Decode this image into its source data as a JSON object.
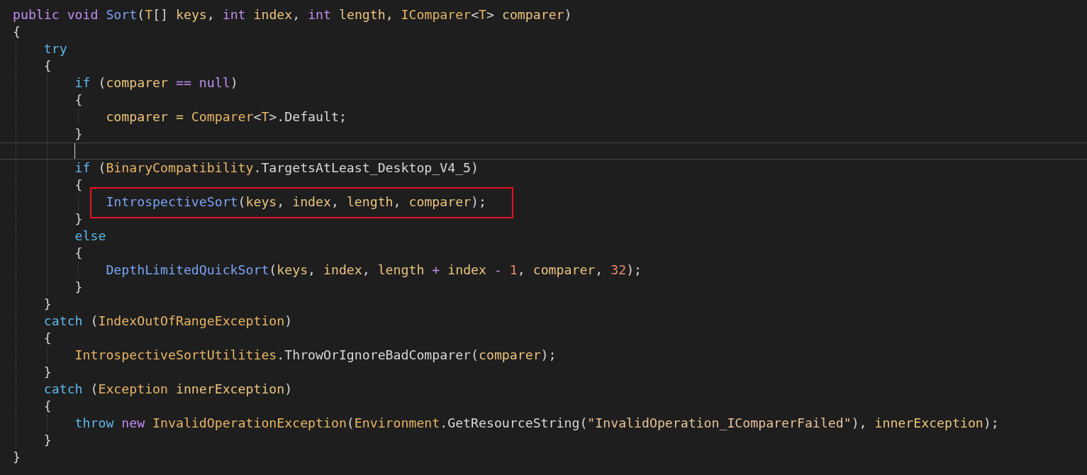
{
  "editor": {
    "lines": [
      {
        "tokens": [
          {
            "text": "public ",
            "kind": "kw"
          },
          {
            "text": "void ",
            "kind": "kw"
          },
          {
            "text": "Sort",
            "kind": "fn"
          },
          {
            "text": "(",
            "kind": "punc"
          },
          {
            "text": "T",
            "kind": "type"
          },
          {
            "text": "[] ",
            "kind": "punc"
          },
          {
            "text": "keys",
            "kind": "var"
          },
          {
            "text": ", ",
            "kind": "punc"
          },
          {
            "text": "int ",
            "kind": "kw"
          },
          {
            "text": "index",
            "kind": "var"
          },
          {
            "text": ", ",
            "kind": "punc"
          },
          {
            "text": "int ",
            "kind": "kw"
          },
          {
            "text": "length",
            "kind": "var"
          },
          {
            "text": ", ",
            "kind": "punc"
          },
          {
            "text": "IComparer",
            "kind": "type"
          },
          {
            "text": "<",
            "kind": "punc"
          },
          {
            "text": "T",
            "kind": "type"
          },
          {
            "text": "> ",
            "kind": "punc"
          },
          {
            "text": "comparer",
            "kind": "var"
          },
          {
            "text": ")",
            "kind": "punc"
          }
        ]
      },
      {
        "tokens": [
          {
            "text": "{",
            "kind": "punc"
          }
        ],
        "children": [
          {
            "tokens": [
              {
                "text": "try",
                "kind": "ctl"
              }
            ]
          },
          {
            "tokens": [
              {
                "text": "{",
                "kind": "punc"
              }
            ],
            "children": [
              {
                "tokens": [
                  {
                    "text": "if ",
                    "kind": "ctl"
                  },
                  {
                    "text": "(",
                    "kind": "punc"
                  },
                  {
                    "text": "comparer ",
                    "kind": "var"
                  },
                  {
                    "text": "== ",
                    "kind": "op"
                  },
                  {
                    "text": "null",
                    "kind": "kw"
                  },
                  {
                    "text": ")",
                    "kind": "punc"
                  }
                ]
              },
              {
                "tokens": [
                  {
                    "text": "{",
                    "kind": "punc"
                  }
                ],
                "children": [
                  {
                    "tokens": [
                      {
                        "text": "comparer = ",
                        "kind": "var"
                      },
                      {
                        "text": "Comparer",
                        "kind": "type"
                      },
                      {
                        "text": "<",
                        "kind": "punc"
                      },
                      {
                        "text": "T",
                        "kind": "type"
                      },
                      {
                        "text": ">.",
                        "kind": "punc"
                      },
                      {
                        "text": "Default",
                        "kind": "member"
                      },
                      {
                        "text": ";",
                        "kind": "punc"
                      }
                    ]
                  }
                ]
              },
              {
                "tokens": [
                  {
                    "text": "}",
                    "kind": "punc"
                  }
                ]
              },
              {
                "current": true
              },
              {
                "tokens": [
                  {
                    "text": "if ",
                    "kind": "ctl"
                  },
                  {
                    "text": "(",
                    "kind": "punc"
                  },
                  {
                    "text": "BinaryCompatibility",
                    "kind": "type"
                  },
                  {
                    "text": ".",
                    "kind": "punc"
                  },
                  {
                    "text": "TargetsAtLeast_Desktop_V4_5",
                    "kind": "member"
                  },
                  {
                    "text": ")",
                    "kind": "punc"
                  }
                ]
              },
              {
                "tokens": [
                  {
                    "text": "{",
                    "kind": "punc"
                  }
                ],
                "children": [
                  {
                    "highlighted": true,
                    "tokens": [
                      {
                        "text": "IntrospectiveSort",
                        "kind": "fn"
                      },
                      {
                        "text": "(",
                        "kind": "punc"
                      },
                      {
                        "text": "keys",
                        "kind": "var"
                      },
                      {
                        "text": ", ",
                        "kind": "punc"
                      },
                      {
                        "text": "index",
                        "kind": "var"
                      },
                      {
                        "text": ", ",
                        "kind": "punc"
                      },
                      {
                        "text": "length",
                        "kind": "var"
                      },
                      {
                        "text": ", ",
                        "kind": "punc"
                      },
                      {
                        "text": "comparer",
                        "kind": "var"
                      },
                      {
                        "text": ");",
                        "kind": "punc"
                      }
                    ]
                  }
                ]
              },
              {
                "tokens": [
                  {
                    "text": "}",
                    "kind": "punc"
                  }
                ]
              },
              {
                "tokens": [
                  {
                    "text": "else",
                    "kind": "ctl"
                  }
                ]
              },
              {
                "tokens": [
                  {
                    "text": "{",
                    "kind": "punc"
                  }
                ],
                "children": [
                  {
                    "tokens": [
                      {
                        "text": "DepthLimitedQuickSort",
                        "kind": "fn"
                      },
                      {
                        "text": "(",
                        "kind": "punc"
                      },
                      {
                        "text": "keys",
                        "kind": "var"
                      },
                      {
                        "text": ", ",
                        "kind": "punc"
                      },
                      {
                        "text": "index",
                        "kind": "var"
                      },
                      {
                        "text": ", ",
                        "kind": "punc"
                      },
                      {
                        "text": "length ",
                        "kind": "var"
                      },
                      {
                        "text": "+ ",
                        "kind": "op"
                      },
                      {
                        "text": "index ",
                        "kind": "var"
                      },
                      {
                        "text": "- ",
                        "kind": "op"
                      },
                      {
                        "text": "1",
                        "kind": "num"
                      },
                      {
                        "text": ", ",
                        "kind": "punc"
                      },
                      {
                        "text": "comparer",
                        "kind": "var"
                      },
                      {
                        "text": ", ",
                        "kind": "punc"
                      },
                      {
                        "text": "32",
                        "kind": "num"
                      },
                      {
                        "text": ");",
                        "kind": "punc"
                      }
                    ]
                  }
                ]
              },
              {
                "tokens": [
                  {
                    "text": "}",
                    "kind": "punc"
                  }
                ]
              }
            ]
          },
          {
            "tokens": [
              {
                "text": "}",
                "kind": "punc"
              }
            ]
          },
          {
            "tokens": [
              {
                "text": "catch ",
                "kind": "ctl"
              },
              {
                "text": "(",
                "kind": "punc"
              },
              {
                "text": "IndexOutOfRangeException",
                "kind": "type"
              },
              {
                "text": ")",
                "kind": "punc"
              }
            ]
          },
          {
            "tokens": [
              {
                "text": "{",
                "kind": "punc"
              }
            ],
            "children": [
              {
                "tokens": [
                  {
                    "text": "IntrospectiveSortUtilities",
                    "kind": "type"
                  },
                  {
                    "text": ".",
                    "kind": "punc"
                  },
                  {
                    "text": "ThrowOrIgnoreBadComparer",
                    "kind": "member"
                  },
                  {
                    "text": "(",
                    "kind": "punc"
                  },
                  {
                    "text": "comparer",
                    "kind": "var"
                  },
                  {
                    "text": ");",
                    "kind": "punc"
                  }
                ]
              }
            ]
          },
          {
            "tokens": [
              {
                "text": "}",
                "kind": "punc"
              }
            ]
          },
          {
            "tokens": [
              {
                "text": "catch ",
                "kind": "ctl"
              },
              {
                "text": "(",
                "kind": "punc"
              },
              {
                "text": "Exception ",
                "kind": "type"
              },
              {
                "text": "innerException",
                "kind": "var"
              },
              {
                "text": ")",
                "kind": "punc"
              }
            ]
          },
          {
            "tokens": [
              {
                "text": "{",
                "kind": "punc"
              }
            ],
            "children": [
              {
                "tokens": [
                  {
                    "text": "throw ",
                    "kind": "ctl"
                  },
                  {
                    "text": "new ",
                    "kind": "kw"
                  },
                  {
                    "text": "InvalidOperationException",
                    "kind": "type"
                  },
                  {
                    "text": "(",
                    "kind": "punc"
                  },
                  {
                    "text": "Environment",
                    "kind": "type"
                  },
                  {
                    "text": ".",
                    "kind": "punc"
                  },
                  {
                    "text": "GetResourceString",
                    "kind": "member"
                  },
                  {
                    "text": "(",
                    "kind": "punc"
                  },
                  {
                    "text": "\"InvalidOperation_IComparerFailed\"",
                    "kind": "str"
                  },
                  {
                    "text": "), ",
                    "kind": "punc"
                  },
                  {
                    "text": "innerException",
                    "kind": "var"
                  },
                  {
                    "text": ");",
                    "kind": "punc"
                  }
                ]
              }
            ]
          },
          {
            "tokens": [
              {
                "text": "}",
                "kind": "punc"
              }
            ]
          }
        ]
      },
      {
        "tokens": [
          {
            "text": "}",
            "kind": "punc"
          }
        ]
      }
    ]
  }
}
